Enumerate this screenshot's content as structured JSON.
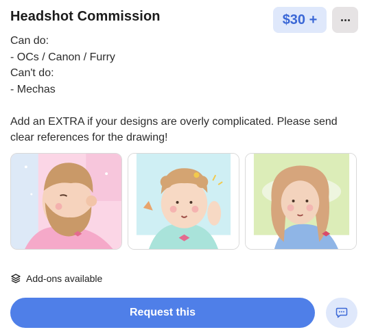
{
  "header": {
    "title": "Headshot Commission",
    "price": "$30 +",
    "more_icon": "ellipsis-icon"
  },
  "description": {
    "lines": [
      "Can do:",
      "- OCs / Canon / Furry",
      "Can't do:",
      "- Mechas",
      "",
      "Add an EXTRA if your designs are overly complicated. Please send",
      "clear references for the drawing!"
    ]
  },
  "gallery": {
    "images": [
      {
        "semantic": "bearded-man-headshot-pink-background"
      },
      {
        "semantic": "curly-haired-character-blue-background"
      },
      {
        "semantic": "long-haired-character-green-background"
      }
    ]
  },
  "addons": {
    "icon": "layers-icon",
    "label": "Add-ons available"
  },
  "actions": {
    "request_label": "Request this",
    "chat_icon": "chat-bubble-icon"
  },
  "colors": {
    "accent": "#4f7fe8",
    "price_bg": "#dfe8fb",
    "price_text": "#3a67d6",
    "more_bg": "#e6e3e4"
  }
}
